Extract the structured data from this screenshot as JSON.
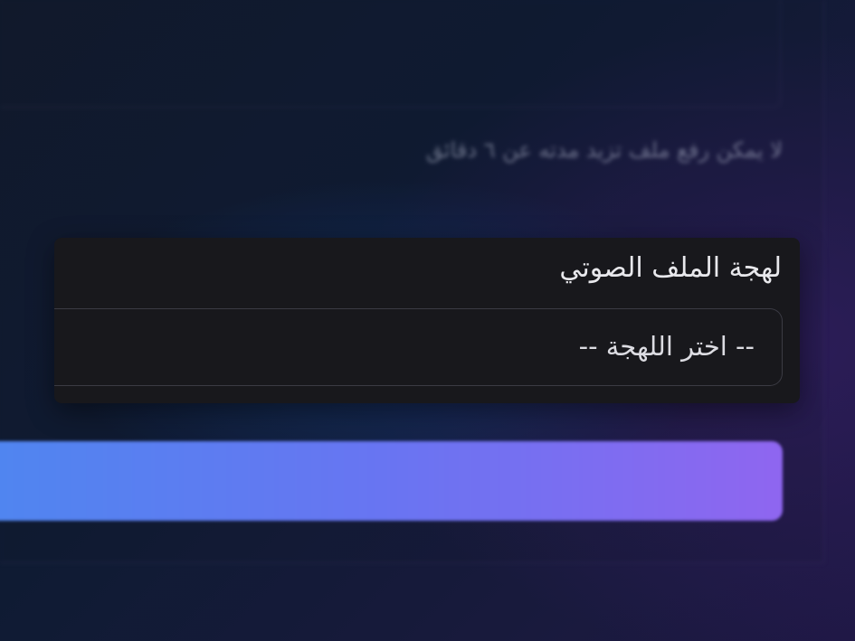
{
  "form": {
    "upload_hint": "لا يمكن رفع ملف تزيد مدته عن ٦ دقائق",
    "dialect_label": "لهجة الملف الصوتي",
    "dialect_select_value": "-- اختر اللهجة --",
    "submit_label": ""
  },
  "colors": {
    "card_background": "#18181c",
    "button_gradient_start": "#4f86f0",
    "button_gradient_end": "#8f66f0"
  }
}
